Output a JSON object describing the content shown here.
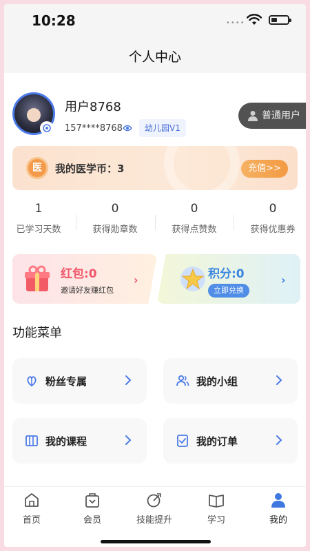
{
  "status": {
    "time": "10:28"
  },
  "header": {
    "title": "个人中心"
  },
  "profile": {
    "username": "用户8768",
    "phone": "157****8768",
    "level": "幼儿园V1",
    "member_type": "普通用户"
  },
  "coin": {
    "label": "我的医学币：3",
    "icon_text": "医",
    "button": "充值>>"
  },
  "stats": [
    {
      "value": "1",
      "label": "已学习天数"
    },
    {
      "value": "0",
      "label": "获得勋章数"
    },
    {
      "value": "0",
      "label": "获得点赞数"
    },
    {
      "value": "0",
      "label": "获得优惠券"
    }
  ],
  "promo": {
    "red_packet": {
      "title": "红包:0",
      "subtitle": "邀请好友赚红包"
    },
    "points": {
      "title": "积分:0",
      "button": "立即兑换"
    }
  },
  "menu": {
    "title": "功能菜单",
    "items": [
      {
        "label": "粉丝专属",
        "icon": "fans-icon"
      },
      {
        "label": "我的小组",
        "icon": "group-icon"
      },
      {
        "label": "我的课程",
        "icon": "course-icon"
      },
      {
        "label": "我的订单",
        "icon": "order-icon"
      }
    ]
  },
  "tabs": [
    {
      "label": "首页",
      "icon": "home-icon"
    },
    {
      "label": "会员",
      "icon": "member-icon"
    },
    {
      "label": "技能提升",
      "icon": "skill-icon"
    },
    {
      "label": "学习",
      "icon": "study-icon"
    },
    {
      "label": "我的",
      "icon": "profile-icon",
      "active": true
    }
  ],
  "colors": {
    "accent": "#4a79e8",
    "coin_orange": "#f39a43",
    "red": "#f0566a",
    "blue": "#3b86e0"
  }
}
